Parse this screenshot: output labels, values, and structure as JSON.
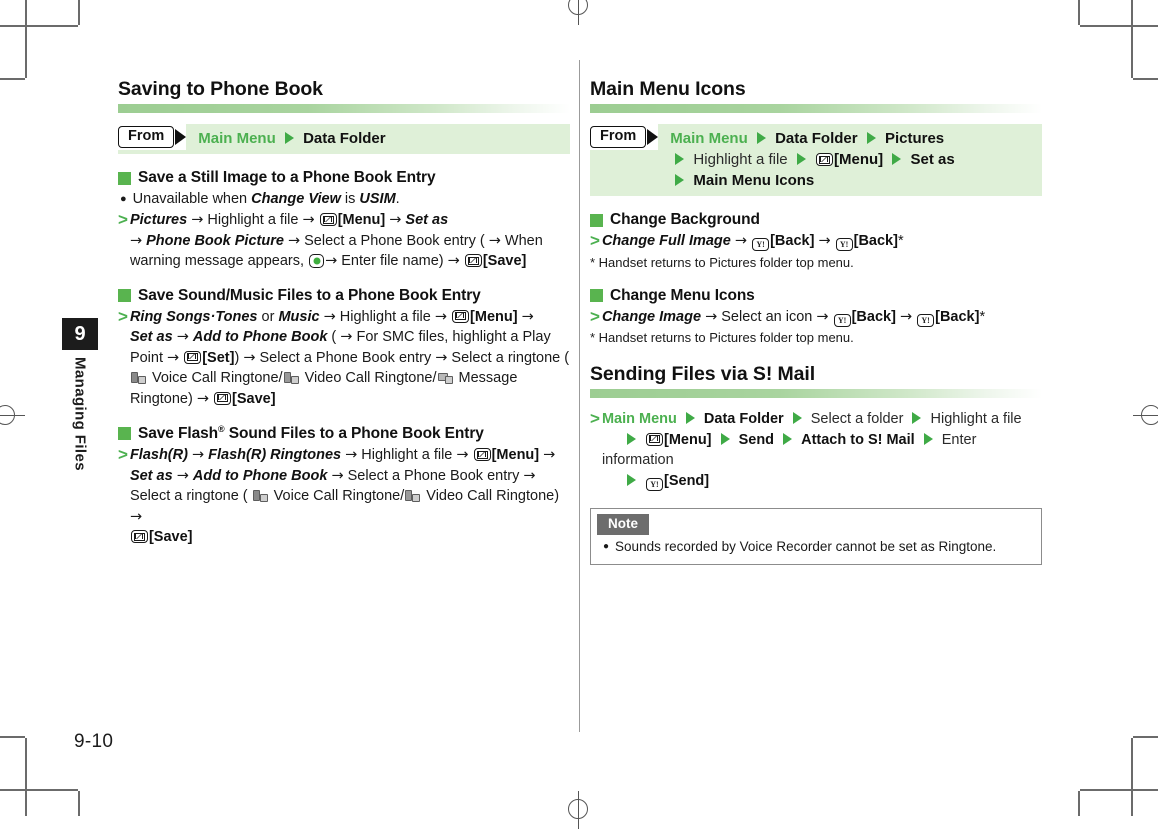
{
  "page": {
    "number": "9-10",
    "chapter_number": "9",
    "chapter_title": "Managing Files"
  },
  "colors": {
    "accent_green": "#4cb050",
    "marker_green": "#59b44f",
    "breadcrumb_bg": "#dff0d8",
    "note_tab": "#6d6d6d"
  },
  "left_column": {
    "section_title": "Saving to Phone Book",
    "from_label": "From",
    "from_lines": [
      [
        {
          "t": "Main Menu",
          "s": "green-bold"
        },
        {
          "t": "▶",
          "s": "tri"
        },
        {
          "t": "Data Folder",
          "s": "black-bold"
        }
      ]
    ],
    "blocks": [
      {
        "heading": "Save a Still Image to a Phone Book Entry",
        "bullet": "Unavailable when Change View is USIM.",
        "bullet_italics": [
          "Change View",
          "USIM"
        ],
        "step_text": "Pictures → Highlight a file → [Menu] → Set as → Phone Book Picture → Select a Phone Book entry ( → When warning message appears, → Enter file name) → [Save]"
      },
      {
        "heading": "Save Sound/Music Files to a Phone Book Entry",
        "step_text": "Ring Songs·Tones or Music → Highlight a file → [Menu] → Set as → Add to Phone Book ( → For SMC files, highlight a Play Point → [Set]) → Select a Phone Book entry → Select a ringtone ( Voice Call Ringtone/ Video Call Ringtone/ Message Ringtone) → [Save]"
      },
      {
        "heading": "Save Flash® Sound Files to a Phone Book Entry",
        "step_text": "Flash(R) → Flash(R) Ringtones → Highlight a file → [Menu] → Set as → Add to Phone Book → Select a Phone Book entry → Select a ringtone ( Voice Call Ringtone/ Video Call Ringtone) → [Save]"
      }
    ],
    "labels": {
      "menu_key": "[Menu]",
      "save_key": "[Save]",
      "set_key": "[Set]",
      "voice_call_ringtone": "Voice Call Ringtone",
      "video_call_ringtone": "Video Call Ringtone",
      "message_ringtone": "Message Ringtone"
    }
  },
  "right_column": {
    "section_title": "Main Menu Icons",
    "from_label": "From",
    "from_line_1": {
      "a": "Main Menu",
      "b": "Data Folder",
      "c": "Pictures"
    },
    "from_line_2": {
      "a": "Highlight a file",
      "b": "[Menu]",
      "c": "Set as"
    },
    "from_line_3": {
      "a": "Main Menu Icons"
    },
    "blocks": [
      {
        "heading": "Change Background",
        "step_text": "Change Full Image → [Back] → [Back]*",
        "footnote": "* Handset returns to Pictures folder top menu."
      },
      {
        "heading": "Change Menu Icons",
        "step_text": "Change Image → Select an icon → [Back] → [Back]*",
        "footnote": "* Handset returns to Pictures folder top menu."
      }
    ],
    "smail": {
      "section_title": "Sending Files via S! Mail",
      "line1": {
        "a": "Main Menu",
        "b": "Data Folder",
        "c": "Select a folder",
        "d": "Highlight a file"
      },
      "line2": {
        "a": "[Menu]",
        "b": "Send",
        "c": "Attach to S! Mail",
        "d": "Enter information"
      },
      "line3": {
        "a": "[Send]"
      }
    },
    "note": {
      "tab_label": "Note",
      "items": [
        "Sounds recorded by Voice Recorder cannot be set as Ringtone."
      ]
    },
    "labels": {
      "back_key": "[Back]",
      "change_full_image": "Change Full Image",
      "change_image": "Change Image",
      "select_an_icon": "Select an icon"
    }
  }
}
